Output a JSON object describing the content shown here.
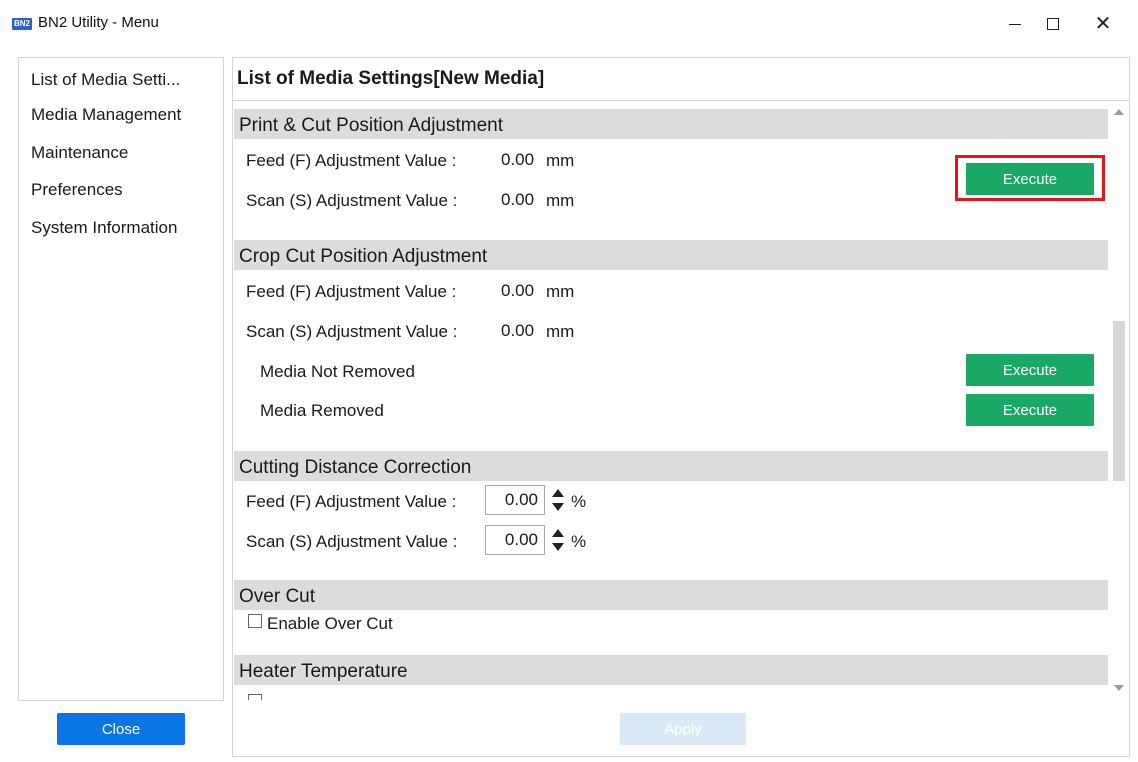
{
  "window": {
    "app_icon_text": "BN2",
    "title": "BN2 Utility - Menu",
    "controls": {
      "minimize": "minimize",
      "maximize": "maximize",
      "close": "close"
    }
  },
  "sidebar": {
    "items": [
      {
        "label": "List of Media Setti..."
      },
      {
        "label": "Media Management"
      },
      {
        "label": "Maintenance"
      },
      {
        "label": "Preferences"
      },
      {
        "label": "System Information"
      }
    ],
    "close_label": "Close"
  },
  "content": {
    "title": "List of Media Settings[New Media]",
    "print_cut": {
      "header": "Print & Cut Position Adjustment",
      "feed_label": "Feed (F) Adjustment Value :",
      "feed_value": "0.00",
      "scan_label": "Scan (S) Adjustment Value :",
      "scan_value": "0.00",
      "unit": "mm",
      "execute_label": "Execute"
    },
    "crop_cut": {
      "header": "Crop Cut Position Adjustment",
      "feed_label": "Feed (F) Adjustment Value :",
      "feed_value": "0.00",
      "scan_label": "Scan (S) Adjustment Value :",
      "scan_value": "0.00",
      "unit": "mm",
      "not_removed_label": "Media Not Removed",
      "removed_label": "Media Removed",
      "execute_label": "Execute"
    },
    "cutting_distance": {
      "header": "Cutting Distance Correction",
      "feed_label": "Feed (F) Adjustment Value :",
      "feed_value": "0.00",
      "scan_label": "Scan (S) Adjustment Value :",
      "scan_value": "0.00",
      "unit": "%"
    },
    "over_cut": {
      "header": "Over Cut",
      "enable_label": "Enable Over Cut",
      "enabled": false
    },
    "heater": {
      "header": "Heater Temperature"
    },
    "apply_label": "Apply"
  },
  "colors": {
    "execute": "#1aa865",
    "close_button": "#0a76e6",
    "apply_disabled": "#d9e9f8",
    "highlight": "#e5141b",
    "section_header": "#dcdcdc"
  }
}
